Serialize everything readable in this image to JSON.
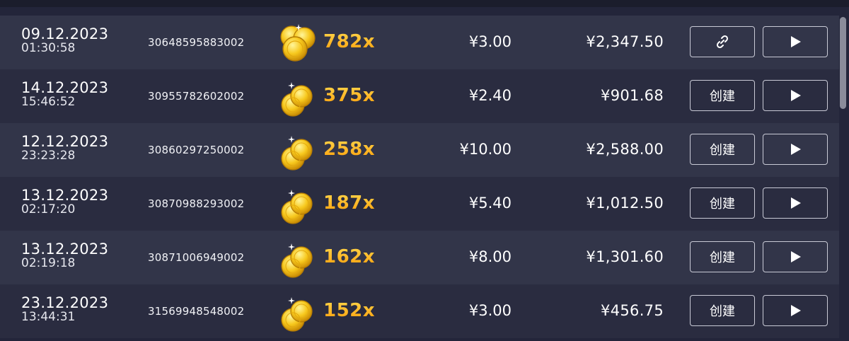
{
  "rows": [
    {
      "date": "09.12.2023",
      "time": "01:30:58",
      "round_id": "30648595883002",
      "multiplier": "782x",
      "bet": "¥3.00",
      "win": "¥2,347.50",
      "action": "link-icon"
    },
    {
      "date": "14.12.2023",
      "time": "15:46:52",
      "round_id": "30955782602002",
      "multiplier": "375x",
      "bet": "¥2.40",
      "win": "¥901.68",
      "action": "创建"
    },
    {
      "date": "12.12.2023",
      "time": "23:23:28",
      "round_id": "30860297250002",
      "multiplier": "258x",
      "bet": "¥10.00",
      "win": "¥2,588.00",
      "action": "创建"
    },
    {
      "date": "13.12.2023",
      "time": "02:17:20",
      "round_id": "30870988293002",
      "multiplier": "187x",
      "bet": "¥5.40",
      "win": "¥1,012.50",
      "action": "创建"
    },
    {
      "date": "13.12.2023",
      "time": "02:19:18",
      "round_id": "30871006949002",
      "multiplier": "162x",
      "bet": "¥8.00",
      "win": "¥1,301.60",
      "action": "创建"
    },
    {
      "date": "23.12.2023",
      "time": "13:44:31",
      "round_id": "31569948548002",
      "multiplier": "152x",
      "bet": "¥3.00",
      "win": "¥456.75",
      "action": "创建"
    }
  ],
  "colors": {
    "background": "#23253a",
    "row_odd": "#323549",
    "row_even": "#2a2c40",
    "multiplier": "#ffae1a",
    "button_border": "#c9cad6"
  },
  "icons": {
    "coins": "gold-coins-icon",
    "play": "play-icon",
    "link": "link-icon"
  }
}
